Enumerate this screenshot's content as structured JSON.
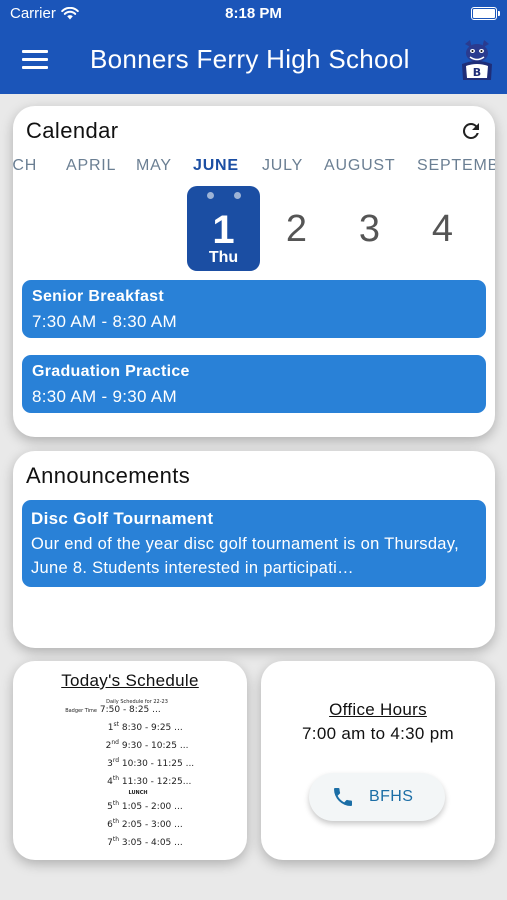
{
  "status_bar": {
    "carrier": "Carrier",
    "time": "8:18 PM",
    "wifi_icon": "wifi-icon",
    "battery_icon": "battery-icon"
  },
  "header": {
    "title": "Bonners Ferry High School",
    "menu_icon": "hamburger-menu-icon",
    "logo_icon": "bulldog-mascot-logo",
    "logo_letter": "B"
  },
  "calendar": {
    "heading": "Calendar",
    "refresh_icon": "refresh-icon",
    "months": [
      "RCH",
      "APRIL",
      "MAY",
      "JUNE",
      "JULY",
      "AUGUST",
      "SEPTEMB"
    ],
    "selected_month": "JUNE",
    "days": [
      {
        "num": "1",
        "dow": "Thu",
        "selected": true
      },
      {
        "num": "2"
      },
      {
        "num": "3"
      },
      {
        "num": "4"
      }
    ],
    "events": [
      {
        "title": "Senior Breakfast",
        "time": "7:30 AM - 8:30 AM"
      },
      {
        "title": "Graduation Practice",
        "time": "8:30 AM - 9:30 AM"
      }
    ]
  },
  "announcements": {
    "heading": "Announcements",
    "items": [
      {
        "title": "Disc Golf Tournament",
        "body": "Our end of the year disc golf tournament is on Thursday, June 8. Students interested in participati…"
      }
    ]
  },
  "schedule": {
    "title": "Today's Schedule",
    "image": {
      "caption": "Daily Schedule for 22-23",
      "bell_label": "Badger Time",
      "bell_time": "7:50 - 8:25 ...",
      "periods": [
        {
          "label": "1st",
          "time": "8:30 - 9:25 ..."
        },
        {
          "label": "2nd",
          "time": "9:30 - 10:25 ..."
        },
        {
          "label": "3rd",
          "time": "10:30 - 11:25 ..."
        },
        {
          "label": "4th",
          "time": "11:30 - 12:25..."
        },
        {
          "label": "5th",
          "time": "1:05 - 2:00 ..."
        },
        {
          "label": "6th",
          "time": "2:05 - 3:00 ..."
        },
        {
          "label": "7th",
          "time": "3:05 - 4:05 ..."
        }
      ],
      "lunch_label": "LUNCH"
    }
  },
  "office": {
    "title": "Office Hours",
    "hours": "7:00 am to 4:30 pm",
    "call_label": "BFHS",
    "phone_icon": "phone-icon",
    "accent_color": "#1b6ea6"
  },
  "colors": {
    "header": "#1b55b9",
    "event": "#2981d7",
    "selected_day": "#1b4ea3",
    "background": "#e9e9e9"
  }
}
